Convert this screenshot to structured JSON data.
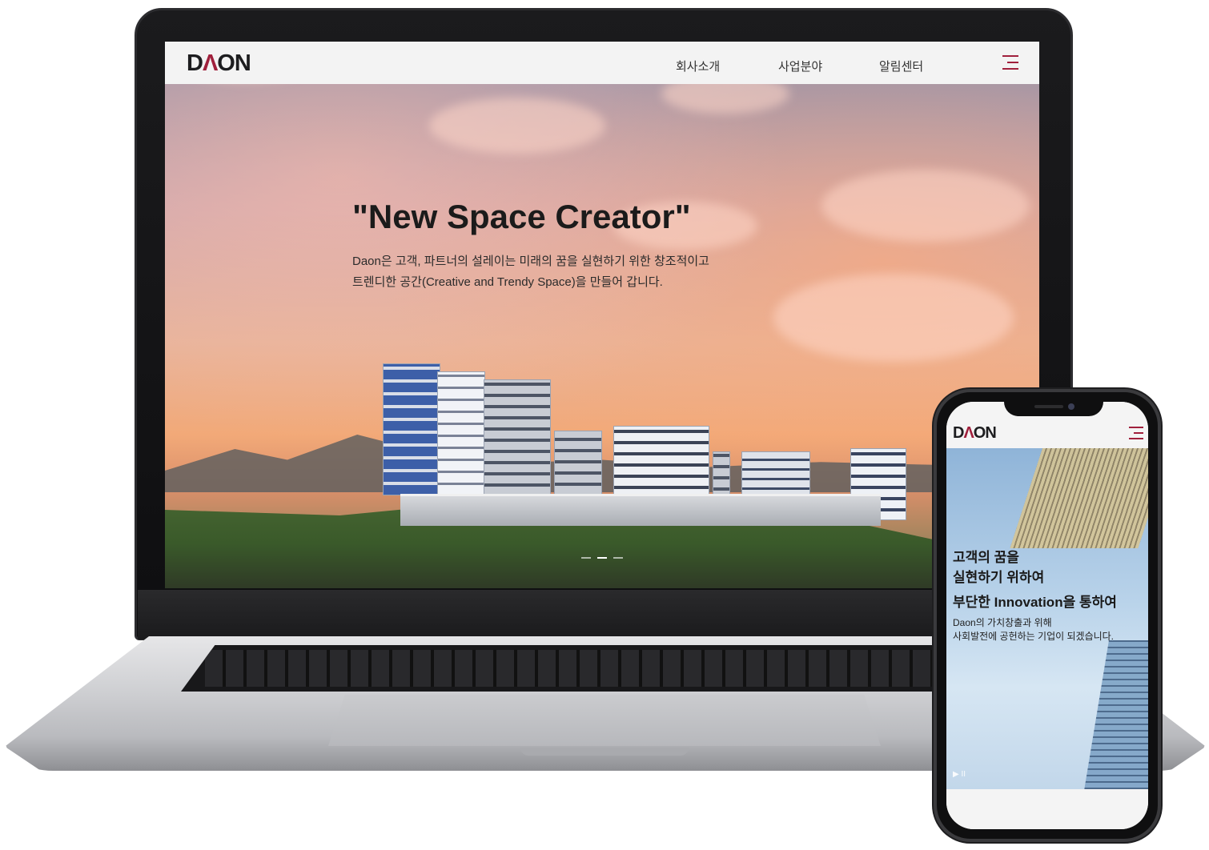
{
  "desktop_site": {
    "logo": {
      "prefix": "D",
      "accent": "Λ",
      "suffix": "ON"
    },
    "nav": [
      "회사소개",
      "사업분야",
      "알림센터"
    ],
    "menu_icon": "hamburger-menu-icon",
    "hero": {
      "title": "\"New Space Creator\"",
      "description_line1": "Daon은 고객, 파트너의 설레이는 미래의 꿈을 실현하기 위한 창조적이고",
      "description_line2": "트렌디한 공간(Creative and Trendy Space)을 만들어 갑니다."
    },
    "slider": {
      "total": 3,
      "active": 2
    }
  },
  "mobile_site": {
    "logo": {
      "prefix": "D",
      "accent": "Λ",
      "suffix": "ON"
    },
    "menu_icon": "hamburger-menu-icon",
    "hero": {
      "title_line1": "고객의 꿈을",
      "title_line2": "실현하기 위하여",
      "title_line3": "부단한 Innovation을 통하여",
      "description_line1": "Daon의 가치창출과 위해",
      "description_line2": "사회발전에 공헌하는 기업이 되겠습니다.",
      "controls": "▶ II"
    }
  },
  "colors": {
    "accent": "#a0203c",
    "header_bg": "#f3f3f3",
    "text_dark": "#1b1b1b"
  }
}
